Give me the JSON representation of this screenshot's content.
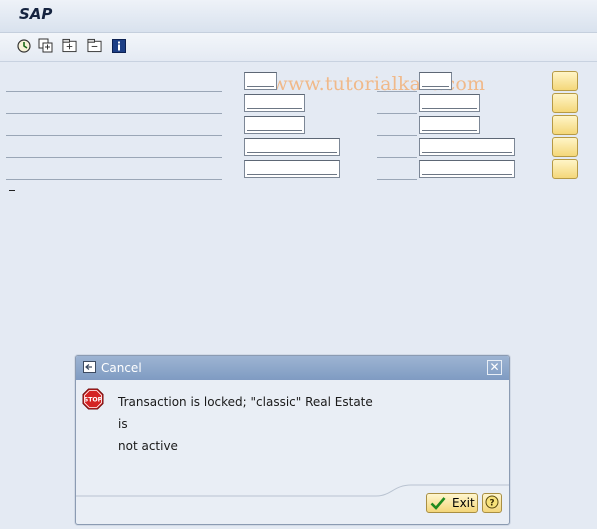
{
  "window": {
    "title": "SAP"
  },
  "watermark": "© www.tutorialkart.com",
  "toolbar": {
    "icons": [
      "execute-icon",
      "copy-icon",
      "expand-icon",
      "collapse-icon",
      "info-icon"
    ]
  },
  "dialog": {
    "title": "Cancel",
    "message_line1": "Transaction is locked; \"classic\" Real Estate is",
    "message_line2": "not active",
    "exit_label": "Exit",
    "icons": {
      "header": "cancel-dialog-icon",
      "message": "stop-icon",
      "exit": "checkmark-icon",
      "help": "help-icon",
      "close": "close-icon"
    }
  },
  "colors": {
    "dialog_header": "#8ea8cc",
    "button_yellow": "#f4d77a",
    "background": "#e4eaf3"
  }
}
